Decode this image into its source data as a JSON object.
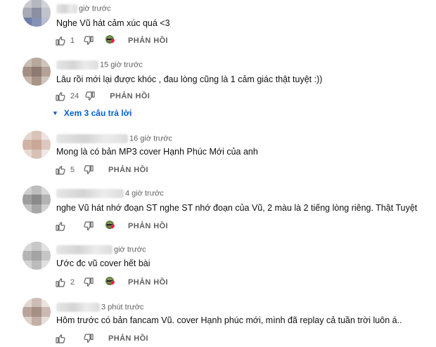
{
  "comments": [
    {
      "time": "giờ trước",
      "text": "Nghe Vũ hát cảm xúc quá <3",
      "likes": "1",
      "hearted": true,
      "reply_label": "PHẢN HỒI",
      "avatar_colors": [
        "#c9c9cf",
        "#b5b7c0",
        "#d2d3d8",
        "#a8aab6",
        "#8c8fa0",
        "#c0c2cc",
        "#6e7ea8",
        "#8592b5",
        "#b9bdd0"
      ]
    },
    {
      "time": "15 giờ trước",
      "text": "Lâu rồi mới lại được khóc , đau lòng cũng là 1 cảm giác thật tuyệt :))",
      "likes": "24",
      "hearted": false,
      "reply_label": "PHẢN HỒI",
      "view_replies": "Xem 3 câu trả lời",
      "avatar_colors": [
        "#c9beb4",
        "#b7a99c",
        "#cfc5bc",
        "#a48f83",
        "#8e7a70",
        "#b3a295",
        "#c7b8ac",
        "#a89587",
        "#d1c6bd"
      ]
    },
    {
      "time": "16 giờ trước",
      "text": "Mong là có bản MP3 cover Hạnh Phúc Mới của anh",
      "likes": "5",
      "hearted": false,
      "reply_label": "PHẢN HỒI",
      "avatar_colors": [
        "#e3d6cf",
        "#d9c3b8",
        "#ece3de",
        "#cfb4a6",
        "#c9a898",
        "#dcc8be",
        "#e6d9d2",
        "#d7c1b6",
        "#efe8e4"
      ]
    },
    {
      "time": "4 giờ trước",
      "text": "nghe Vũ hát nhớ đoạn ST nghe ST nhớ đoạn của Vũ, 2 màu là 2 tiếng lòng riêng. Thật Tuyệt",
      "likes": "",
      "hearted": true,
      "reply_label": "PHẢN HỒI",
      "avatar_colors": [
        "#cfcfcf",
        "#bdbdbd",
        "#d8d8d8",
        "#9e9e9e",
        "#8a8a8a",
        "#b3b3b3",
        "#c4c4c4",
        "#a6a6a6",
        "#d0d0d0"
      ]
    },
    {
      "time": "giờ trước",
      "text": "Ước đc vũ cover hết bài",
      "likes": "2",
      "hearted": true,
      "reply_label": "PHẢN HỒI",
      "avatar_colors": [
        "#d8d8d8",
        "#c8c8c8",
        "#e2e2e2",
        "#b4b4b4",
        "#a4a4a4",
        "#c6c6c6",
        "#d4d4d4",
        "#bcbcbc",
        "#e0e0e0"
      ]
    },
    {
      "time": "3 phút trước",
      "text": "Hôm trước có bản fancam Vũ. cover Hạnh phúc mới, mình đã replay cả tuần trời luôn á..",
      "likes": "",
      "hearted": false,
      "reply_label": "PHẢN HỒI",
      "avatar_colors": [
        "#e2d8d3",
        "#cdbdb6",
        "#eae3df",
        "#b9a39a",
        "#a68f86",
        "#cbb9b1",
        "#ddd1cb",
        "#c2afa7",
        "#e7dfdb"
      ]
    }
  ],
  "colors": {
    "link": "#065fd4",
    "heart": "#ff1744",
    "meta": "#606060",
    "text": "#0f0f0f"
  },
  "icons": [
    "thumb-up-icon",
    "thumb-down-icon",
    "heart-icon",
    "chevron-down-icon"
  ]
}
